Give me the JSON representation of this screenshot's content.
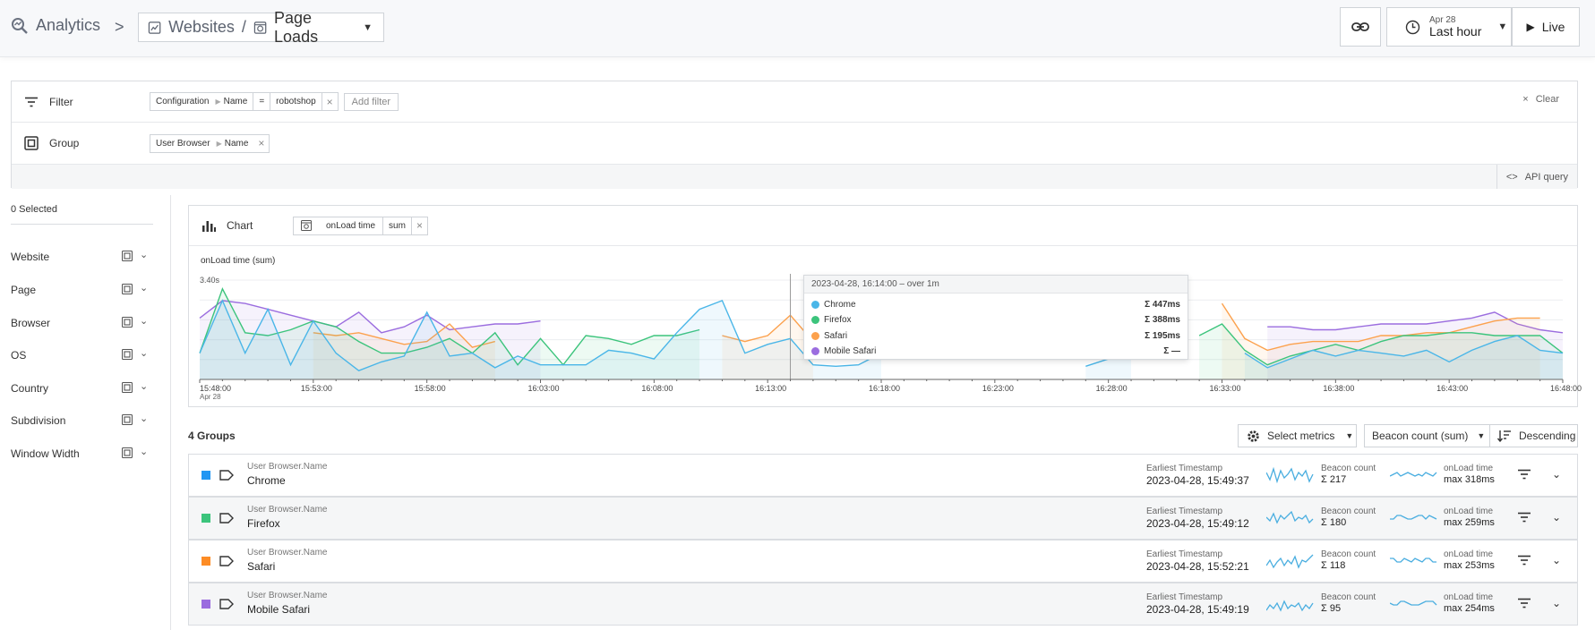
{
  "header": {
    "app": "Analytics",
    "crumb_sep": ">",
    "websites": "Websites",
    "slash": "/",
    "page": "Page Loads",
    "date_small": "Apr 28",
    "range": "Last hour",
    "live": "Live"
  },
  "filter": {
    "label": "Filter",
    "chip": [
      "Configuration",
      "Name",
      "=",
      "robotshop"
    ],
    "add": "Add filter",
    "clear": "Clear"
  },
  "group": {
    "label": "Group",
    "chip": [
      "User Browser",
      "Name"
    ]
  },
  "api_query": "API query",
  "sidebar": {
    "selected": "0 Selected",
    "items": [
      "Website",
      "Page",
      "Browser",
      "OS",
      "Country",
      "Subdivision",
      "Window Width"
    ]
  },
  "chart": {
    "panel_label": "Chart",
    "metric_chip": [
      "onLoad time",
      "sum"
    ],
    "title": "onLoad time (sum)",
    "ytick": "3.40s",
    "xticks": [
      "15:48:00",
      "15:53:00",
      "15:58:00",
      "16:03:00",
      "16:08:00",
      "16:13:00",
      "16:18:00",
      "16:23:00",
      "16:28:00",
      "16:33:00",
      "16:38:00",
      "16:43:00",
      "16:48:00"
    ],
    "xsub": "Apr 28"
  },
  "chart_data": {
    "type": "line",
    "title": "onLoad time (sum)",
    "xlabel": "",
    "ylabel": "",
    "ylim": [
      0,
      3.4
    ],
    "x": [
      "15:48",
      "15:49",
      "15:50",
      "15:51",
      "15:52",
      "15:53",
      "15:54",
      "15:55",
      "15:56",
      "15:57",
      "15:58",
      "15:59",
      "16:00",
      "16:01",
      "16:02",
      "16:03",
      "16:04",
      "16:05",
      "16:06",
      "16:07",
      "16:08",
      "16:09",
      "16:10",
      "16:11",
      "16:12",
      "16:13",
      "16:14",
      "16:15",
      "16:16",
      "16:17",
      "16:18",
      "16:19",
      "16:20",
      "16:21",
      "16:22",
      "16:23",
      "16:24",
      "16:25",
      "16:26",
      "16:27",
      "16:28",
      "16:29",
      "16:30",
      "16:31",
      "16:32",
      "16:33",
      "16:34",
      "16:35",
      "16:36",
      "16:37",
      "16:38",
      "16:39",
      "16:40",
      "16:41",
      "16:42",
      "16:43",
      "16:44",
      "16:45",
      "16:46",
      "16:47",
      "16:48"
    ],
    "series": [
      {
        "name": "Chrome",
        "color": "#4ab6e8",
        "values": [
          0.9,
          2.7,
          0.9,
          2.4,
          0.5,
          2.0,
          0.9,
          0.3,
          0.6,
          0.8,
          2.3,
          0.8,
          0.9,
          0.4,
          0.8,
          0.5,
          0.5,
          0.5,
          1.0,
          0.9,
          0.7,
          1.6,
          2.4,
          2.7,
          0.9,
          1.2,
          1.4,
          0.5,
          0.45,
          0.5,
          0.9,
          null,
          null,
          null,
          null,
          null,
          null,
          null,
          null,
          0.45,
          0.7,
          1.0,
          null,
          null,
          null,
          null,
          0.9,
          0.4,
          0.7,
          1.0,
          0.8,
          1.0,
          0.9,
          0.8,
          1.0,
          0.6,
          1.0,
          1.3,
          1.5,
          1.0,
          0.9
        ]
      },
      {
        "name": "Firefox",
        "color": "#3cc47c",
        "values": [
          0.9,
          3.1,
          1.6,
          1.5,
          1.7,
          2.0,
          1.8,
          1.3,
          0.9,
          0.9,
          1.1,
          1.4,
          0.9,
          1.6,
          0.5,
          1.4,
          0.5,
          1.5,
          1.4,
          1.2,
          1.5,
          1.5,
          1.7,
          null,
          null,
          null,
          null,
          null,
          null,
          null,
          null,
          null,
          null,
          null,
          null,
          null,
          null,
          null,
          null,
          null,
          null,
          null,
          null,
          null,
          1.5,
          1.9,
          1.0,
          0.5,
          0.8,
          1.0,
          1.2,
          1.0,
          1.3,
          1.5,
          1.5,
          1.6,
          1.6,
          1.5,
          1.5,
          1.5,
          0.9
        ]
      },
      {
        "name": "Safari",
        "color": "#fca14d",
        "values": [
          null,
          null,
          null,
          null,
          null,
          1.6,
          1.5,
          1.6,
          1.4,
          1.2,
          1.3,
          1.9,
          1.1,
          1.3,
          null,
          null,
          null,
          null,
          null,
          null,
          null,
          null,
          null,
          1.5,
          1.3,
          1.5,
          2.2,
          1.3,
          null,
          null,
          null,
          null,
          null,
          null,
          null,
          null,
          null,
          null,
          null,
          null,
          null,
          null,
          null,
          null,
          null,
          2.6,
          1.4,
          1.0,
          1.2,
          1.3,
          1.3,
          1.3,
          1.5,
          1.5,
          1.6,
          1.6,
          1.8,
          2.0,
          2.1,
          2.1,
          null
        ]
      },
      {
        "name": "Mobile Safari",
        "color": "#9b6ddf",
        "values": [
          2.1,
          2.7,
          2.6,
          2.4,
          2.2,
          2.0,
          1.8,
          2.3,
          1.6,
          1.8,
          2.2,
          1.7,
          1.8,
          1.9,
          1.9,
          2.0,
          null,
          null,
          null,
          null,
          null,
          null,
          null,
          null,
          null,
          null,
          null,
          null,
          null,
          null,
          null,
          null,
          null,
          null,
          null,
          null,
          null,
          null,
          null,
          null,
          null,
          null,
          null,
          null,
          null,
          null,
          null,
          1.8,
          1.8,
          1.7,
          1.7,
          1.8,
          1.9,
          1.9,
          1.9,
          2.0,
          2.1,
          2.3,
          1.9,
          1.7,
          1.6
        ]
      }
    ]
  },
  "tooltip": {
    "header": "2023-04-28, 16:14:00 – over 1m",
    "rows": [
      {
        "name": "Chrome",
        "value": "Σ 447ms",
        "color": "#4ab6e8"
      },
      {
        "name": "Firefox",
        "value": "Σ 388ms",
        "color": "#3cc47c"
      },
      {
        "name": "Safari",
        "value": "Σ 195ms",
        "color": "#fca14d"
      },
      {
        "name": "Mobile Safari",
        "value": "Σ —",
        "color": "#9b6ddf"
      }
    ]
  },
  "groups": {
    "title": "4 Groups",
    "select_metrics": "Select metrics",
    "sort_by": "Beacon count (sum)",
    "order": "Descending",
    "row_sub": "User Browser.Name",
    "ts_label": "Earliest Timestamp",
    "m1_label": "Beacon count",
    "m2_label": "onLoad time",
    "rows": [
      {
        "name": "Chrome",
        "color": "#2196f3",
        "ts": "2023-04-28, 15:49:37",
        "beacon": "Σ 217",
        "onload": "max 318ms"
      },
      {
        "name": "Firefox",
        "color": "#3cc47c",
        "ts": "2023-04-28, 15:49:12",
        "beacon": "Σ 180",
        "onload": "max 259ms"
      },
      {
        "name": "Safari",
        "color": "#fd8c25",
        "ts": "2023-04-28, 15:52:21",
        "beacon": "Σ 118",
        "onload": "max 253ms"
      },
      {
        "name": "Mobile Safari",
        "color": "#9b6ddf",
        "ts": "2023-04-28, 15:49:19",
        "beacon": "Σ 95",
        "onload": "max 254ms"
      }
    ]
  }
}
